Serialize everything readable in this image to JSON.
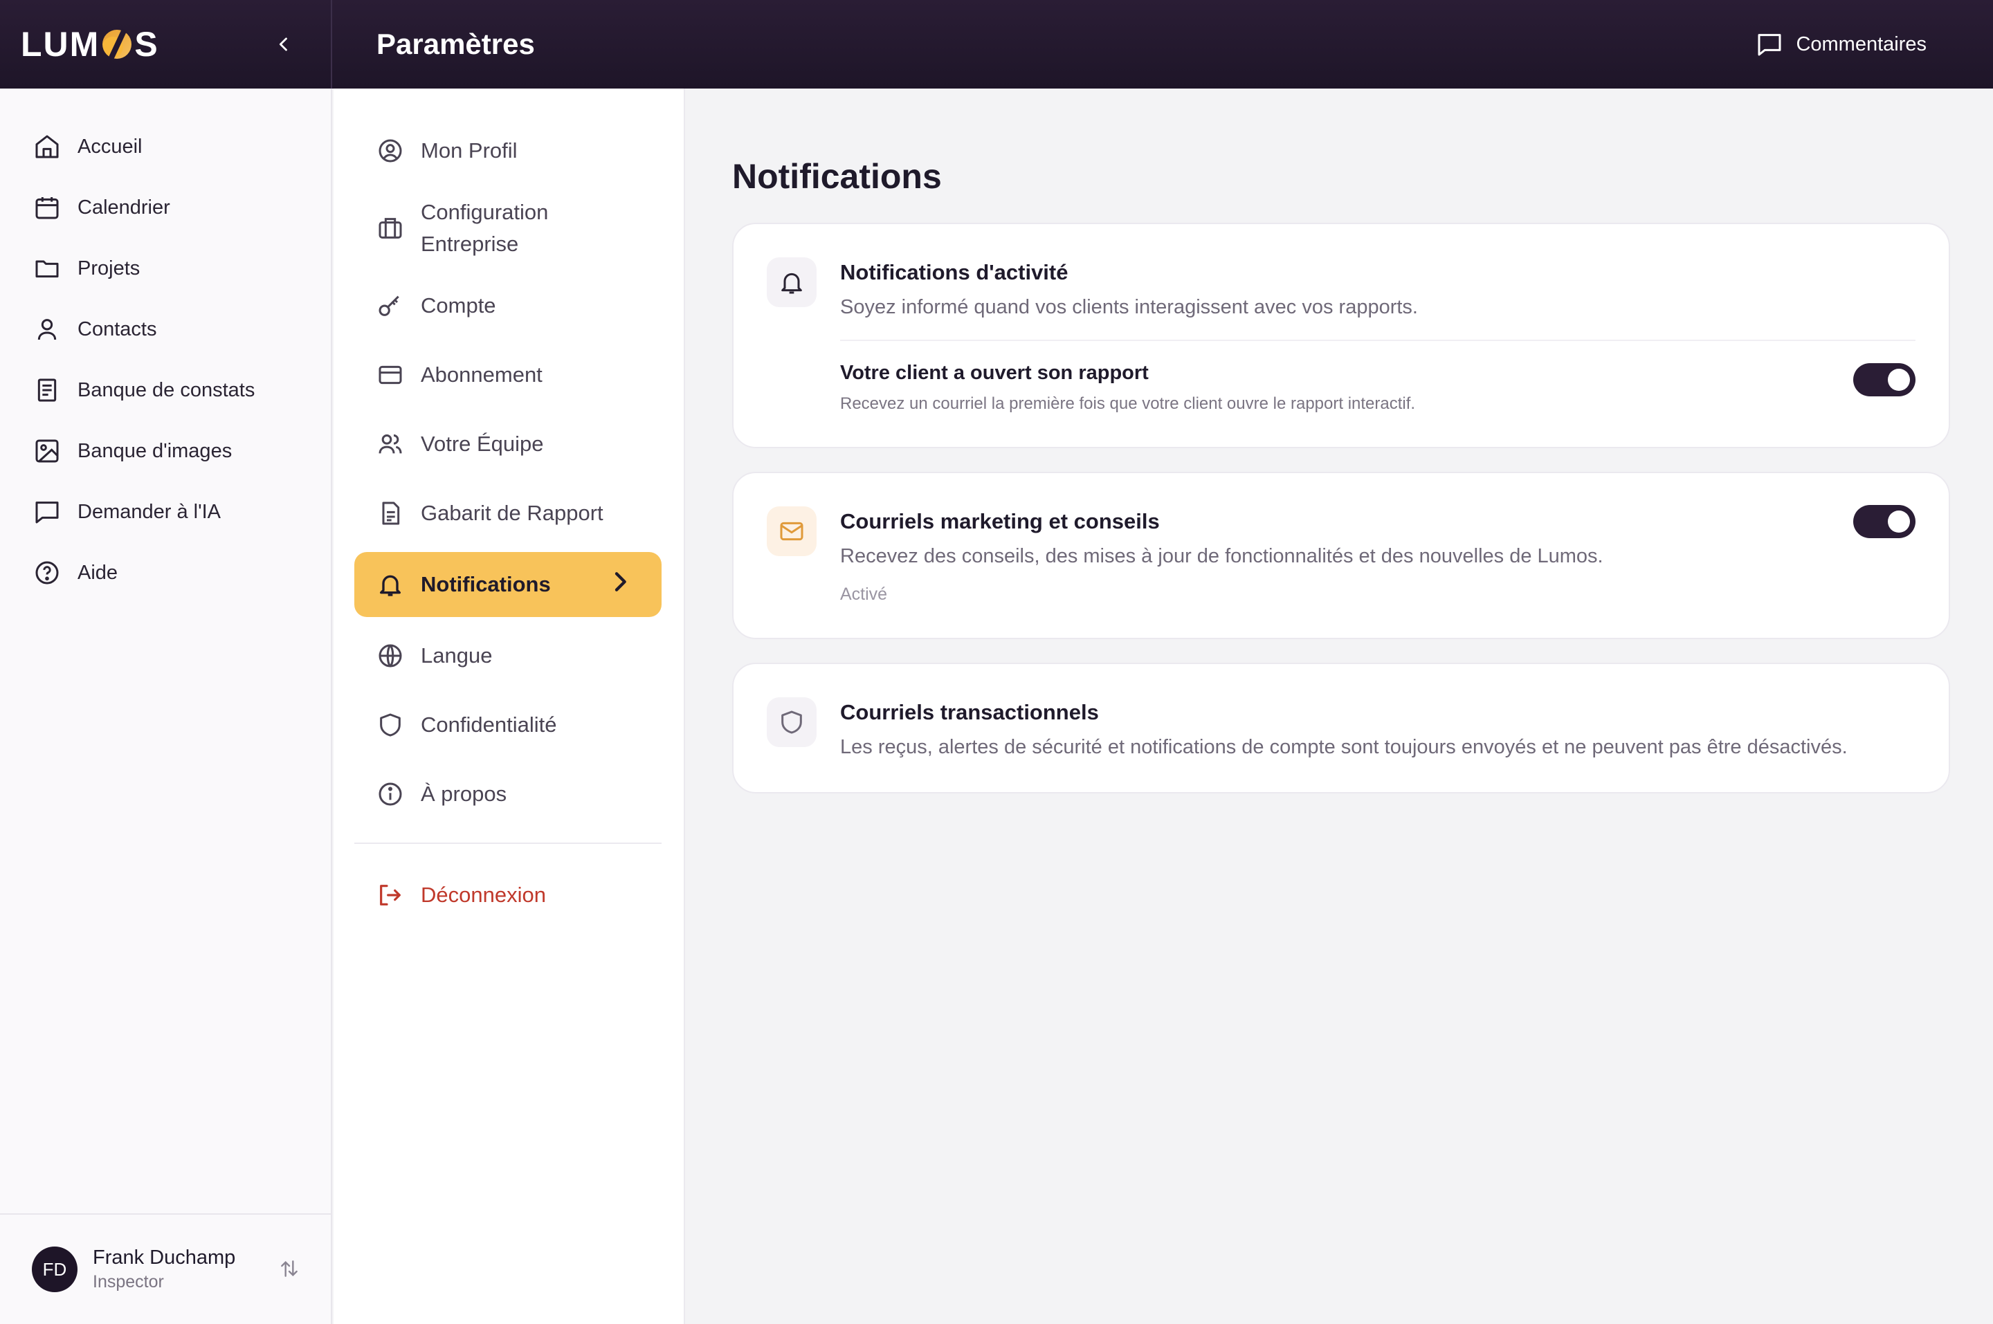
{
  "app": {
    "logo_text_left": "LUM",
    "logo_text_right": "S",
    "page_title": "Paramètres",
    "feedback_label": "Commentaires"
  },
  "sidebar": {
    "items": [
      {
        "label": "Accueil",
        "icon": "home-icon"
      },
      {
        "label": "Calendrier",
        "icon": "calendar-icon"
      },
      {
        "label": "Projets",
        "icon": "folder-icon"
      },
      {
        "label": "Contacts",
        "icon": "user-icon"
      },
      {
        "label": "Banque de constats",
        "icon": "document-icon"
      },
      {
        "label": "Banque d'images",
        "icon": "image-icon"
      },
      {
        "label": "Demander à l'IA",
        "icon": "chat-icon"
      },
      {
        "label": "Aide",
        "icon": "help-icon"
      }
    ],
    "user": {
      "initials": "FD",
      "name": "Frank Duchamp",
      "role": "Inspector"
    }
  },
  "settings_menu": {
    "items": [
      {
        "label": "Mon Profil",
        "icon": "profile-icon"
      },
      {
        "label": "Configuration Entreprise",
        "icon": "briefcase-icon"
      },
      {
        "label": "Compte",
        "icon": "key-icon"
      },
      {
        "label": "Abonnement",
        "icon": "credit-card-icon"
      },
      {
        "label": "Votre Équipe",
        "icon": "team-icon"
      },
      {
        "label": "Gabarit de Rapport",
        "icon": "file-icon"
      },
      {
        "label": "Notifications",
        "icon": "bell-icon",
        "active": true
      },
      {
        "label": "Langue",
        "icon": "globe-icon"
      },
      {
        "label": "Confidentialité",
        "icon": "shield-icon"
      },
      {
        "label": "À propos",
        "icon": "info-icon"
      }
    ],
    "logout_label": "Déconnexion"
  },
  "main": {
    "title": "Notifications",
    "cards": [
      {
        "title": "Notifications d'activité",
        "description": "Soyez informé quand vos clients interagissent avec vos rapports.",
        "icon": "bell-icon",
        "sub": {
          "title": "Votre client a ouvert son rapport",
          "description": "Recevez un courriel la première fois que votre client ouvre le rapport interactif.",
          "enabled": true
        }
      },
      {
        "title": "Courriels marketing et conseils",
        "description": "Recevez des conseils, des mises à jour de fonctionnalités et des nouvelles de Lumos.",
        "status": "Activé",
        "icon": "mail-icon",
        "enabled": true
      },
      {
        "title": "Courriels transactionnels",
        "description": "Les reçus, alertes de sécurité et notifications de compte sont toujours envoyés et ne peuvent pas être désactivés.",
        "icon": "shield-icon"
      }
    ]
  },
  "colors": {
    "topbar": "#1e1528",
    "accent": "#f8c35a",
    "toggle_on": "#2a1d35",
    "logout": "#c0392b"
  }
}
